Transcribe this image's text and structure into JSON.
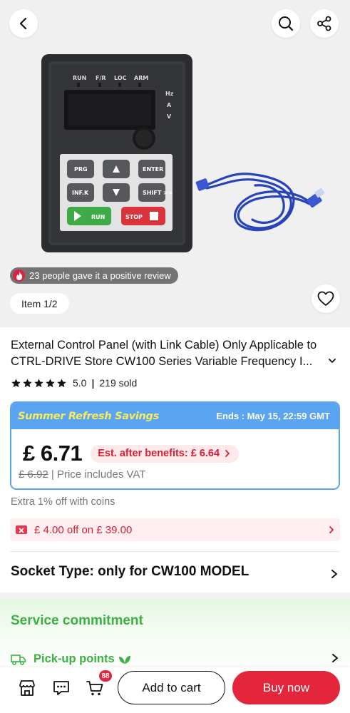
{
  "gallery": {
    "review_badge": "23 people gave it a positive review",
    "item_counter": "Item 1/2",
    "device_labels": {
      "leds": [
        "RUN",
        "F/R",
        "LOC",
        "ARM"
      ],
      "units": [
        "Hz",
        "A",
        "V"
      ],
      "keys": [
        "PRG",
        "ENTER",
        "INF.K",
        "SHIFT >>",
        "RUN",
        "STOP"
      ]
    }
  },
  "product": {
    "title": "External Control Panel (with Link Cable) Only Applicable to CTRL-DRIVE Store CW100 Series Variable Frequency I...",
    "rating": "5.0",
    "sold": "219 sold"
  },
  "promo": {
    "name": "Summer Refresh Savings",
    "ends": "Ends :  May 15, 22:59 GMT",
    "price": "£ 6.71",
    "est_after_benefits": "Est. after benefits: £ 6.64",
    "old_price": "£ 6.92",
    "vat_note": "Price includes VAT"
  },
  "coins_note": "Extra 1% off with coins",
  "coupon": "£ 4.00 off on £ 39.00",
  "socket_type": "Socket Type: only for CW100 MODEL",
  "service": {
    "title": "Service commitment",
    "pickup": "Pick-up points"
  },
  "bottom_bar": {
    "cart_badge": "88",
    "add_to_cart": "Add to cart",
    "buy_now": "Buy now"
  },
  "colors": {
    "accent_red": "#e3263b",
    "promo_blue": "#5aa4f2",
    "promo_yellow": "#f8ec5a",
    "service_green": "#3cb043"
  }
}
